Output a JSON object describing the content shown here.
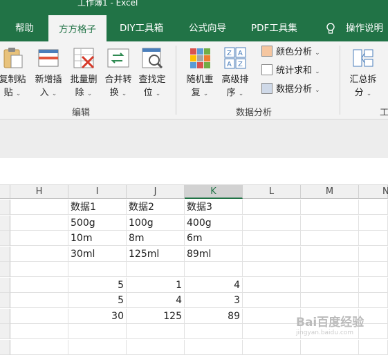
{
  "window": {
    "title": "工作簿1 - Excel"
  },
  "tabs": [
    "帮助",
    "方方格子",
    "DIY工具箱",
    "公式向导",
    "PDF工具集",
    "操作说明"
  ],
  "ribbon": {
    "edit_group": {
      "label": "编辑",
      "buttons": [
        {
          "l1": "复制粘",
          "l2": "贴"
        },
        {
          "l1": "新增插",
          "l2": "入"
        },
        {
          "l1": "批量删",
          "l2": "除"
        },
        {
          "l1": "合并转",
          "l2": "换"
        },
        {
          "l1": "查找定",
          "l2": "位"
        }
      ]
    },
    "analysis_group": {
      "label": "数据分析",
      "buttons": [
        {
          "l1": "随机重",
          "l2": "复"
        },
        {
          "l1": "高级排",
          "l2": "序"
        }
      ],
      "small": [
        "颜色分析",
        "统计求和",
        "数据分析"
      ]
    },
    "summary_button": {
      "l1": "汇总拆",
      "l2": "分"
    },
    "cut_label": "工"
  },
  "sheet": {
    "columns": [
      "H",
      "I",
      "J",
      "K",
      "L",
      "M",
      "N"
    ],
    "selected_column": "K",
    "rows": [
      [
        "",
        "数据1",
        "数据2",
        "数据3",
        "",
        "",
        ""
      ],
      [
        "",
        "500g",
        "100g",
        "400g",
        "",
        "",
        ""
      ],
      [
        "",
        "10m",
        "8m",
        "6m",
        "",
        "",
        ""
      ],
      [
        "",
        "30ml",
        "125ml",
        "89ml",
        "",
        "",
        ""
      ],
      [
        "",
        "",
        "",
        "",
        "",
        "",
        ""
      ],
      [
        "",
        "5",
        "1",
        "4",
        "",
        "",
        ""
      ],
      [
        "",
        "5",
        "4",
        "3",
        "",
        "",
        ""
      ],
      [
        "",
        "30",
        "125",
        "89",
        "",
        "",
        ""
      ],
      [
        "",
        "",
        "",
        "",
        "",
        "",
        ""
      ],
      [
        "",
        "",
        "",
        "",
        "",
        "",
        ""
      ]
    ]
  },
  "watermark": {
    "line1": "Bai百度经验",
    "line2": "jingyan.baidu.com"
  }
}
